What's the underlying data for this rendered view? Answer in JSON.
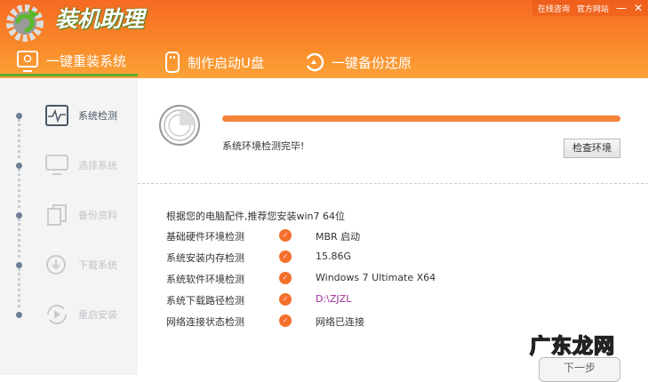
{
  "app": {
    "title": "装机助理",
    "top_links": [
      "在线咨询",
      "官方网站"
    ],
    "minimize": "—",
    "close": "✕"
  },
  "nav": [
    {
      "label": "一键重装系统",
      "active": true
    },
    {
      "label": "制作启动U盘"
    },
    {
      "label": "一键备份还原"
    }
  ],
  "steps": [
    {
      "label": "系统检测",
      "active": true
    },
    {
      "label": "选择系统"
    },
    {
      "label": "备份资料"
    },
    {
      "label": "下载系统"
    },
    {
      "label": "重启安装"
    }
  ],
  "progress": {
    "percent": 100,
    "status": "系统环境检测完毕!",
    "button": "检查环境"
  },
  "recommendation": "根据您的电脑配件,推荐您安装win7 64位",
  "checks": [
    {
      "label": "基础硬件环境检测",
      "value": "MBR 启动"
    },
    {
      "label": "系统安装内存检测",
      "value": "15.86G"
    },
    {
      "label": "系统软件环境检测",
      "value": "Windows 7 Ultimate X64"
    },
    {
      "label": "系统下载路径检测",
      "value": "D:\\ZJZL",
      "color": "#a0309a"
    },
    {
      "label": "网络连接状态检测",
      "value": "网络已连接"
    }
  ],
  "next_button": "下一步",
  "watermark": "广东龙网"
}
